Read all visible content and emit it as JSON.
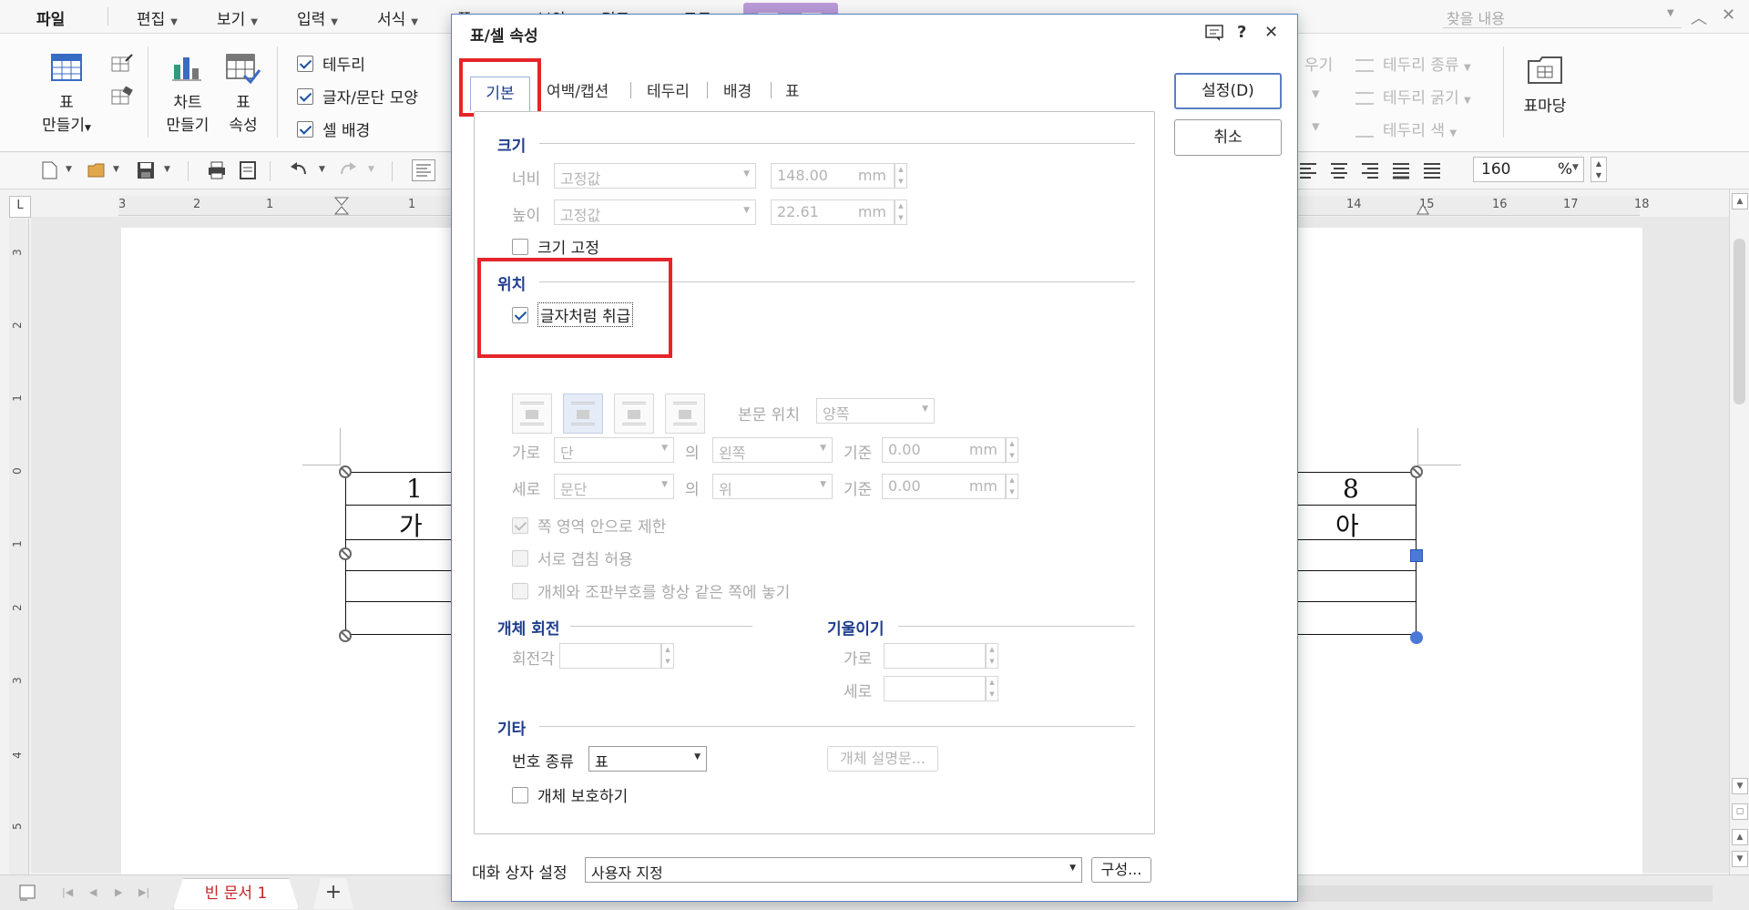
{
  "menubar": {
    "file": "파일",
    "items": [
      "편집",
      "보기",
      "입력",
      "서식",
      "쪽",
      "보안",
      "검토",
      "도구"
    ],
    "search_placeholder": "찾을 내용"
  },
  "ribbon": {
    "table_make_line1": "표",
    "table_make_line2": "만들기",
    "chart_line1": "차트",
    "chart_line2": "만들기",
    "table_prop_line1": "표",
    "table_prop_line2": "속성",
    "check_border": "테두리",
    "check_font": "글자/문단 모양",
    "check_cellbg": "셀 배경",
    "border_type": "테두리 종류",
    "border_width": "테두리 굵기",
    "border_color": "테두리 색",
    "partial_1": "우기",
    "table_yard": "표마당"
  },
  "toolbar": {
    "zoom_value": "160",
    "zoom_unit": "%"
  },
  "ruler": {
    "h_numbers": [
      "3",
      "2",
      "1",
      "1",
      "14",
      "15",
      "16",
      "17",
      "18"
    ],
    "v_numbers": [
      "3",
      "2",
      "1",
      "0",
      "1",
      "2",
      "3",
      "4",
      "5"
    ],
    "corner": "L"
  },
  "document": {
    "cells_left": [
      "1",
      "가"
    ],
    "cells_right": [
      "8",
      "아"
    ]
  },
  "status": {
    "doc_tab": "빈 문서 1",
    "add_tab": "+"
  },
  "dialog": {
    "title": "표/셀 속성",
    "tabs": [
      "기본",
      "여백/캡션",
      "테두리",
      "배경",
      "표"
    ],
    "ok": "설정(D)",
    "cancel": "취소",
    "size": {
      "title": "크기",
      "width_label": "너비",
      "width_mode": "고정값",
      "width_value": "148.00",
      "height_label": "높이",
      "height_mode": "고정값",
      "height_value": "22.61",
      "unit": "mm",
      "fix_size": "크기 고정"
    },
    "position": {
      "title": "위치",
      "treat_as_char": "글자처럼 취급",
      "body_pos_label": "본문 위치",
      "body_pos_value": "양쪽",
      "horiz_label": "가로",
      "horiz_value": "단",
      "of": "의",
      "horiz_ref": "왼쪽",
      "base": "기준",
      "horiz_base": "0.00",
      "vert_label": "세로",
      "vert_value": "문단",
      "vert_ref": "위",
      "vert_base": "0.00",
      "unit": "mm",
      "limit_area": "쪽 영역 안으로 제한",
      "allow_overlap": "서로 겹침 허용",
      "same_page": "개체와 조판부호를 항상 같은 쪽에 놓기"
    },
    "rotation": {
      "title": "개체 회전",
      "angle": "회전각"
    },
    "skew": {
      "title": "기울이기",
      "horiz": "가로",
      "vert": "세로"
    },
    "etc": {
      "title": "기타",
      "number_type_label": "번호 종류",
      "number_type_value": "표",
      "desc_button": "개체 설명문...",
      "protect": "개체 보호하기"
    },
    "footer": {
      "label": "대화 상자 설정",
      "value": "사용자 지정",
      "config": "구성..."
    }
  }
}
